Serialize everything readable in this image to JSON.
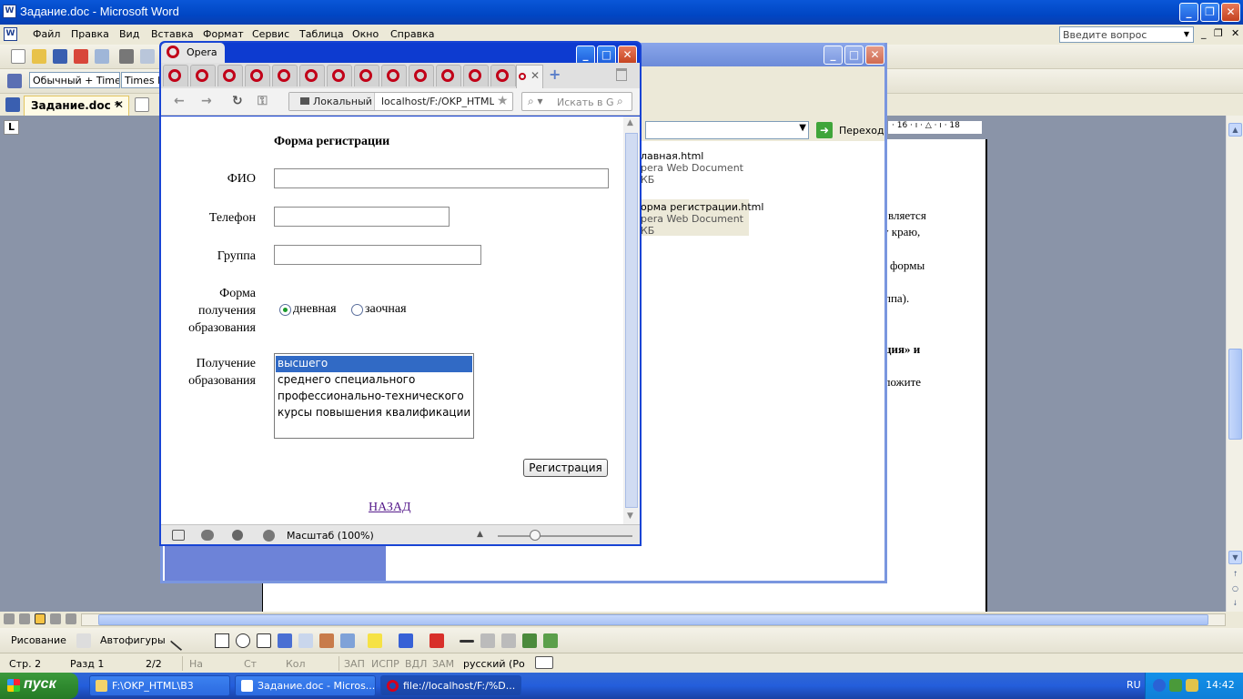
{
  "word": {
    "title": "Задание.doc - Microsoft Word",
    "menu": [
      "Файл",
      "Правка",
      "Вид",
      "Вставка",
      "Формат",
      "Сервис",
      "Таблица",
      "Окно",
      "Справка"
    ],
    "ask_placeholder": "Введите вопрос",
    "style_box": "Обычный + Time",
    "font_box": "Times N",
    "doc_tab": "Задание.doc  *",
    "ruler_marks": "· 16 · ı · △ · ı · 18",
    "doc_text": [
      "вляется",
      "у краю,",
      "формы",
      "ппа).",
      "ция»   и",
      "ложите"
    ],
    "drawing_label": "Рисование",
    "autoshapes_label": "Автофигуры",
    "status": {
      "page": "Стр. 2",
      "section": "Разд 1",
      "pages": "2/2",
      "at": "На",
      "line": "Ст",
      "col": "Кол",
      "rec": "ЗАП",
      "trk": "ИСПР",
      "ext": "ВДЛ",
      "ovr": "ЗАМ",
      "lang": "русский (Ро"
    }
  },
  "explorer": {
    "go_label": "Переход",
    "files": [
      {
        "name": "лавная.html",
        "type": "pera Web Document",
        "size": "КБ"
      },
      {
        "name": "орма регистрации.html",
        "type": "pera Web Document",
        "size": "КБ"
      }
    ]
  },
  "opera": {
    "title": "Opera",
    "addr_local": "Локальный",
    "addr_url": "localhost/F:/OKP_HTML/E",
    "search_placeholder": "Искать в Gc",
    "status_zoom": "Масштаб (100%)",
    "zoom_percent": 100,
    "form": {
      "title": "Форма регистрации",
      "fio_label": "ФИО",
      "phone_label": "Телефон",
      "group_label": "Группа",
      "study_form_label_1": "Форма",
      "study_form_label_2": "получения",
      "study_form_label_3": "образования",
      "radio_day": "дневная",
      "radio_extramural": "заочная",
      "edu_label_1": "Получение",
      "edu_label_2": "образования",
      "edu_options": [
        "высшего",
        "среднего специального",
        "профессионально-технического",
        "курсы повышения квалификации"
      ],
      "submit": "Регистрация",
      "back_link": "НАЗАД"
    }
  },
  "taskbar": {
    "start": "пуск",
    "tasks": [
      "F:\\OKP_HTML\\B3",
      "Задание.doc - Micros...",
      "file://localhost/F:/%D..."
    ],
    "lang": "RU",
    "time": "14:42"
  }
}
